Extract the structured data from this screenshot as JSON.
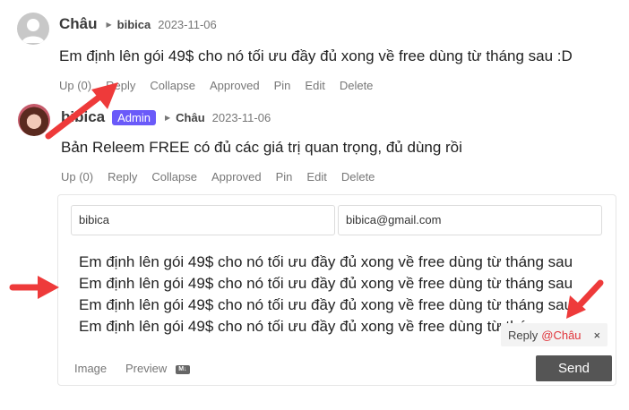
{
  "comments": [
    {
      "author": "Châu",
      "reply_to": "bibica",
      "date": "2023-11-06",
      "content": "Em định lên gói 49$ cho nó tối ưu đầy đủ xong về free dùng từ tháng sau :D",
      "actions": {
        "up": "Up (0)",
        "reply": "Reply",
        "collapse": "Collapse",
        "approved": "Approved",
        "pin": "Pin",
        "edit": "Edit",
        "delete": "Delete"
      }
    },
    {
      "author": "bibica",
      "badge": "Admin",
      "reply_to": "Châu",
      "date": "2023-11-06",
      "content": "Bản Releem FREE có đủ các giá trị quan trọng, đủ dùng rồi",
      "actions": {
        "up": "Up (0)",
        "reply": "Reply",
        "collapse": "Collapse",
        "approved": "Approved",
        "pin": "Pin",
        "edit": "Edit",
        "delete": "Delete"
      }
    }
  ],
  "reply_form": {
    "name_value": "bibica",
    "email_value": "bibica@gmail.com",
    "text_lines": [
      "Em định lên gói 49$ cho nó tối ưu đầy đủ xong về free dùng từ tháng sau",
      "Em định lên gói 49$ cho nó tối ưu đầy đủ xong về free dùng từ tháng sau",
      "Em định lên gói 49$ cho nó tối ưu đầy đủ xong về free dùng từ tháng sau",
      "Em định lên gói 49$ cho nó tối ưu đầy đủ xong về free dùng từ tháng sau"
    ],
    "reply_tag_label": "Reply",
    "reply_tag_mention": "@Châu",
    "reply_tag_close": "×",
    "image_label": "Image",
    "preview_label": "Preview",
    "markdown_icon": "M↓",
    "send_label": "Send"
  },
  "colors": {
    "admin_badge": "#6a5af9",
    "mention": "#e0343a",
    "annotation_arrow": "#ee3a3a",
    "send_button": "#555555"
  }
}
